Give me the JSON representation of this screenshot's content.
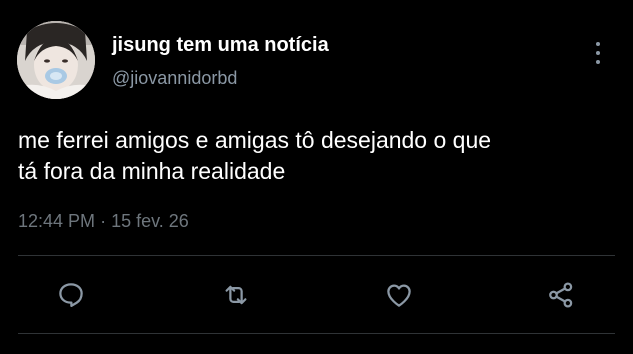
{
  "user": {
    "display_name": "jisung tem uma notícia",
    "handle": "@jiovannidorbd"
  },
  "tweet": {
    "lines": [
      "me ferrei amigos e amigas tô desejando o que",
      "tá fora da minha realidade"
    ],
    "time": "12:44 PM",
    "separator": "·",
    "date": "15 fev. 26"
  },
  "icons": {
    "more": "more-vertical-icon",
    "reply": "reply-icon",
    "retweet": "retweet-icon",
    "like": "heart-icon",
    "share": "share-icon"
  },
  "colors": {
    "background": "#000000",
    "text": "#ffffff",
    "secondary": "#8b98a5",
    "divider": "#2f3336"
  }
}
